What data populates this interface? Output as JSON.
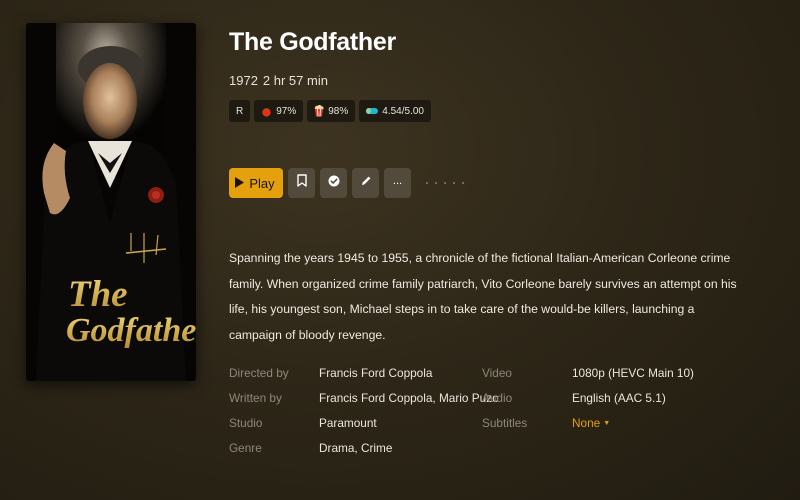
{
  "movie": {
    "title": "The Godfather",
    "year": "1972",
    "duration": "2 hr 57 min",
    "summary": "Spanning the years 1945 to 1955, a chronicle of the fictional Italian-American Corleone crime family. When organized crime family patriarch, Vito Corleone barely survives an attempt on his life, his youngest son, Michael steps in to take care of the would-be killers, launching a campaign of bloody revenge."
  },
  "poster": {
    "logo_text": "The Godfather"
  },
  "ratings": {
    "content_rating": "R",
    "critic_score": "97%",
    "critic_icon": "tomato-icon",
    "audience_score": "98%",
    "audience_icon": "popcorn-icon",
    "tmdb_score": "4.54/5.00",
    "tmdb_icon": "tmdb-icon"
  },
  "actions": {
    "play_label": "Play",
    "play_icon": "play-icon",
    "watchlist_icon": "bookmark-icon",
    "watched_icon": "check-circle-icon",
    "edit_icon": "pencil-icon",
    "more_label": "..."
  },
  "details": {
    "left": [
      {
        "label": "Directed by",
        "value": "Francis Ford Coppola"
      },
      {
        "label": "Written by",
        "value": "Francis Ford Coppola, Mario Puzo"
      },
      {
        "label": "Studio",
        "value": "Paramount"
      },
      {
        "label": "Genre",
        "value": "Drama, Crime"
      }
    ],
    "right": [
      {
        "label": "Video",
        "value": "1080p (HEVC Main 10)"
      },
      {
        "label": "Audio",
        "value": "English (AAC 5.1)"
      },
      {
        "label": "Subtitles",
        "value": "None"
      }
    ]
  },
  "colors": {
    "accent": "#e5a00d",
    "background": "#2e2718",
    "button": "#524a3a"
  }
}
